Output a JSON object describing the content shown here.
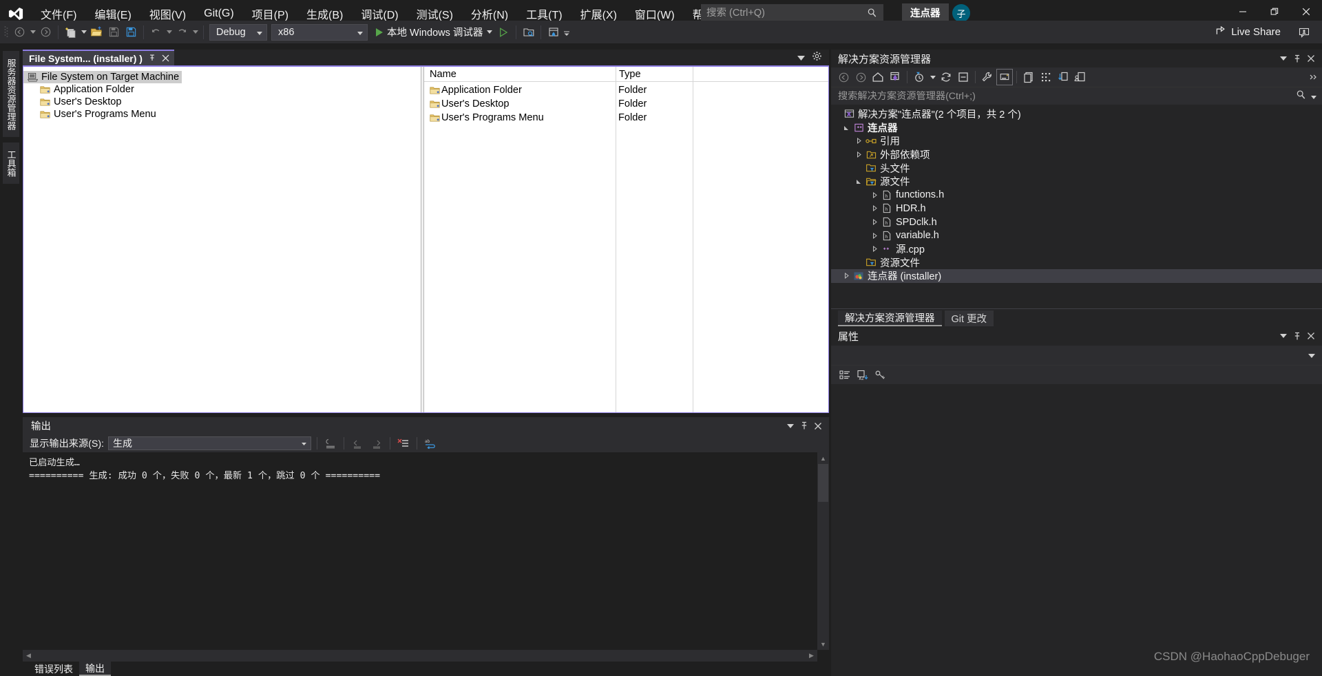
{
  "app": {
    "title_chip": "连点器",
    "user_initial": "子"
  },
  "menu": {
    "items": [
      {
        "label": "文件(F)",
        "name": "menu-file"
      },
      {
        "label": "编辑(E)",
        "name": "menu-edit"
      },
      {
        "label": "视图(V)",
        "name": "menu-view"
      },
      {
        "label": "Git(G)",
        "name": "menu-git"
      },
      {
        "label": "项目(P)",
        "name": "menu-project"
      },
      {
        "label": "生成(B)",
        "name": "menu-build"
      },
      {
        "label": "调试(D)",
        "name": "menu-debug"
      },
      {
        "label": "测试(S)",
        "name": "menu-test"
      },
      {
        "label": "分析(N)",
        "name": "menu-analyze"
      },
      {
        "label": "工具(T)",
        "name": "menu-tools"
      },
      {
        "label": "扩展(X)",
        "name": "menu-extensions"
      },
      {
        "label": "窗口(W)",
        "name": "menu-window"
      },
      {
        "label": "帮助(H)",
        "name": "menu-help"
      }
    ]
  },
  "search": {
    "placeholder": "搜索 (Ctrl+Q)",
    "value": ""
  },
  "toolbar": {
    "configuration": "Debug",
    "platform": "x86",
    "run_label": "本地 Windows 调试器",
    "live_share": "Live Share"
  },
  "left_strip": {
    "tabs": [
      {
        "label": "服务器资源管理器",
        "name": "vtab-server-explorer"
      },
      {
        "label": "工具箱",
        "name": "vtab-toolbox"
      }
    ]
  },
  "designer": {
    "tab_title": "File System...  (installer) )",
    "tree": {
      "root": "File System on Target Machine",
      "children": [
        "Application Folder",
        "User's Desktop",
        "User's Programs Menu"
      ]
    },
    "list": {
      "columns": [
        "Name",
        "Type"
      ],
      "rows": [
        {
          "name": "Application Folder",
          "type": "Folder"
        },
        {
          "name": "User's Desktop",
          "type": "Folder"
        },
        {
          "name": "User's Programs Menu",
          "type": "Folder"
        }
      ]
    }
  },
  "output": {
    "title": "输出",
    "source_label": "显示输出来源(S):",
    "source_value": "生成",
    "lines": [
      "已启动生成…",
      "========== 生成: 成功 0 个，失败 0 个，最新 1 个，跳过 0 个 =========="
    ],
    "tabs": [
      {
        "label": "错误列表",
        "name": "bottom-tab-error-list",
        "active": false
      },
      {
        "label": "输出",
        "name": "bottom-tab-output",
        "active": true
      }
    ]
  },
  "solution_explorer": {
    "title": "解决方案资源管理器",
    "search_placeholder": "搜索解决方案资源管理器(Ctrl+;)",
    "tree": [
      {
        "label": "解决方案\"连点器\"(2 个项目，共 2 个)",
        "indent": 0,
        "icon": "solution-icon",
        "expander": "none",
        "bold": false,
        "selected": false
      },
      {
        "label": "连点器",
        "indent": 1,
        "icon": "cpp-project-icon",
        "expander": "expanded",
        "bold": true,
        "selected": false
      },
      {
        "label": "引用",
        "indent": 2,
        "icon": "references-icon",
        "expander": "collapsed",
        "bold": false,
        "selected": false
      },
      {
        "label": "外部依赖项",
        "indent": 2,
        "icon": "external-deps-icon",
        "expander": "collapsed",
        "bold": false,
        "selected": false
      },
      {
        "label": "头文件",
        "indent": 2,
        "icon": "filter-folder-icon",
        "expander": "none",
        "bold": false,
        "selected": false
      },
      {
        "label": "源文件",
        "indent": 2,
        "icon": "filter-folder-open-icon",
        "expander": "expanded",
        "bold": false,
        "selected": false
      },
      {
        "label": "functions.h",
        "indent": 3,
        "icon": "header-file-icon",
        "expander": "collapsed",
        "bold": false,
        "selected": false
      },
      {
        "label": "HDR.h",
        "indent": 3,
        "icon": "header-file-icon",
        "expander": "collapsed",
        "bold": false,
        "selected": false
      },
      {
        "label": "SPDclk.h",
        "indent": 3,
        "icon": "header-file-icon",
        "expander": "collapsed",
        "bold": false,
        "selected": false
      },
      {
        "label": "variable.h",
        "indent": 3,
        "icon": "header-file-icon",
        "expander": "collapsed",
        "bold": false,
        "selected": false
      },
      {
        "label": "源.cpp",
        "indent": 3,
        "icon": "cpp-file-icon",
        "expander": "collapsed",
        "bold": false,
        "selected": false
      },
      {
        "label": "资源文件",
        "indent": 2,
        "icon": "filter-folder-icon",
        "expander": "none",
        "bold": false,
        "selected": false
      },
      {
        "label": "连点器 (installer)",
        "indent": 1,
        "icon": "setup-project-icon",
        "expander": "collapsed",
        "bold": false,
        "selected": true
      }
    ],
    "tabs": [
      {
        "label": "解决方案资源管理器",
        "name": "dock-tab-solution-explorer",
        "active": true
      },
      {
        "label": "Git 更改",
        "name": "dock-tab-git-changes",
        "active": false
      }
    ]
  },
  "properties": {
    "title": "属性"
  },
  "watermark": "CSDN @HaohaoCppDebuger",
  "colors": {
    "accent": "#8d7ce2",
    "chrome": "#2d2d30",
    "background": "#1f1f1f",
    "panel": "#252526",
    "avatar": "#01617b",
    "run_green": "#57a64a"
  }
}
